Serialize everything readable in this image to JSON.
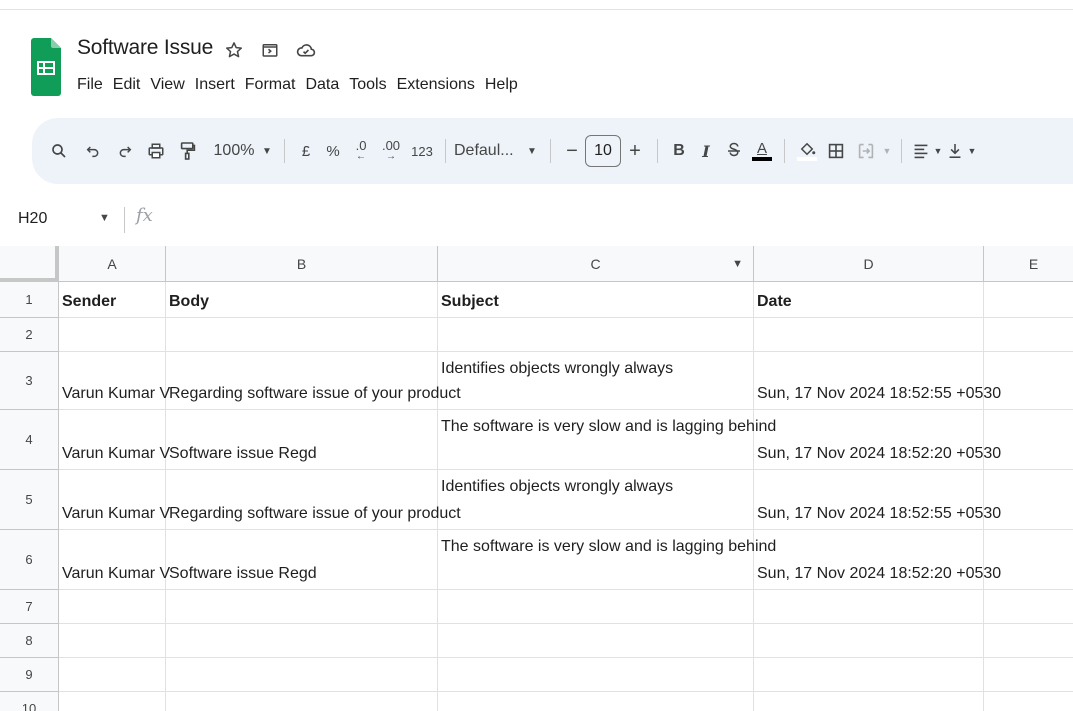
{
  "document": {
    "title": "Software Issue",
    "title_icons": [
      "star-icon",
      "move-to-folder-icon",
      "cloud-status-icon"
    ]
  },
  "menu": [
    "File",
    "Edit",
    "View",
    "Insert",
    "Format",
    "Data",
    "Tools",
    "Extensions",
    "Help"
  ],
  "toolbar": {
    "zoom": "100%",
    "currency": "£",
    "percent": "%",
    "decrease_decimal": ".0",
    "increase_decimal": ".00",
    "number_format": "123",
    "font": "Defaul...",
    "font_size": "10",
    "minus": "−",
    "plus": "+",
    "bold": "B",
    "italic": "I",
    "text_color_letter": "A"
  },
  "formula_bar": {
    "cell_ref": "H20",
    "fx": "fx"
  },
  "columns": [
    "A",
    "B",
    "C",
    "D",
    "E"
  ],
  "rows": [
    {
      "num": "1",
      "cells": [
        {
          "top": "",
          "bottom": "Sender",
          "bold": true
        },
        {
          "top": "",
          "bottom": "Body",
          "bold": true
        },
        {
          "top": "",
          "bottom": "Subject",
          "bold": true
        },
        {
          "top": "",
          "bottom": "Date",
          "bold": true
        },
        {
          "top": "",
          "bottom": ""
        }
      ]
    },
    {
      "num": "2",
      "cells": [
        {
          "top": "",
          "bottom": ""
        },
        {
          "top": "",
          "bottom": ""
        },
        {
          "top": "",
          "bottom": ""
        },
        {
          "top": "",
          "bottom": ""
        },
        {
          "top": "",
          "bottom": ""
        }
      ]
    },
    {
      "num": "3",
      "cells": [
        {
          "top": "",
          "bottom": "Varun Kumar V"
        },
        {
          "top": "",
          "bottom": "Regarding software issue of your product"
        },
        {
          "top": "Identifies objects wrongly always",
          "bottom": ""
        },
        {
          "top": "",
          "bottom": "Sun, 17 Nov 2024 18:52:55 +0530"
        },
        {
          "top": "",
          "bottom": ""
        }
      ]
    },
    {
      "num": "4",
      "cells": [
        {
          "top": "",
          "bottom": "Varun Kumar V"
        },
        {
          "top": "",
          "bottom": "Software issue Regd"
        },
        {
          "top": "The software is very slow and is lagging behind",
          "bottom": ""
        },
        {
          "top": "",
          "bottom": "Sun, 17 Nov 2024 18:52:20 +0530"
        },
        {
          "top": "",
          "bottom": ""
        }
      ]
    },
    {
      "num": "5",
      "cells": [
        {
          "top": "",
          "bottom": "Varun Kumar V"
        },
        {
          "top": "",
          "bottom": "Regarding software issue of your product"
        },
        {
          "top": "Identifies objects wrongly always",
          "bottom": ""
        },
        {
          "top": "",
          "bottom": "Sun, 17 Nov 2024 18:52:55 +0530"
        },
        {
          "top": "",
          "bottom": ""
        }
      ]
    },
    {
      "num": "6",
      "cells": [
        {
          "top": "",
          "bottom": "Varun Kumar V"
        },
        {
          "top": "",
          "bottom": "Software issue Regd"
        },
        {
          "top": "The software is very slow and is lagging behind",
          "bottom": ""
        },
        {
          "top": "",
          "bottom": "Sun, 17 Nov 2024 18:52:20 +0530"
        },
        {
          "top": "",
          "bottom": ""
        }
      ]
    },
    {
      "num": "7",
      "cells": [
        {
          "top": "",
          "bottom": ""
        },
        {
          "top": "",
          "bottom": ""
        },
        {
          "top": "",
          "bottom": ""
        },
        {
          "top": "",
          "bottom": ""
        },
        {
          "top": "",
          "bottom": ""
        }
      ]
    },
    {
      "num": "8",
      "cells": [
        {
          "top": "",
          "bottom": ""
        },
        {
          "top": "",
          "bottom": ""
        },
        {
          "top": "",
          "bottom": ""
        },
        {
          "top": "",
          "bottom": ""
        },
        {
          "top": "",
          "bottom": ""
        }
      ]
    },
    {
      "num": "9",
      "cells": [
        {
          "top": "",
          "bottom": ""
        },
        {
          "top": "",
          "bottom": ""
        },
        {
          "top": "",
          "bottom": ""
        },
        {
          "top": "",
          "bottom": ""
        },
        {
          "top": "",
          "bottom": ""
        }
      ]
    },
    {
      "num": "10",
      "cells": [
        {
          "top": "",
          "bottom": ""
        },
        {
          "top": "",
          "bottom": ""
        },
        {
          "top": "",
          "bottom": ""
        },
        {
          "top": "",
          "bottom": ""
        },
        {
          "top": "",
          "bottom": ""
        }
      ]
    }
  ],
  "colors": {
    "sheets_green": "#0f9d58",
    "toolbar_bg": "#eef2f9"
  }
}
